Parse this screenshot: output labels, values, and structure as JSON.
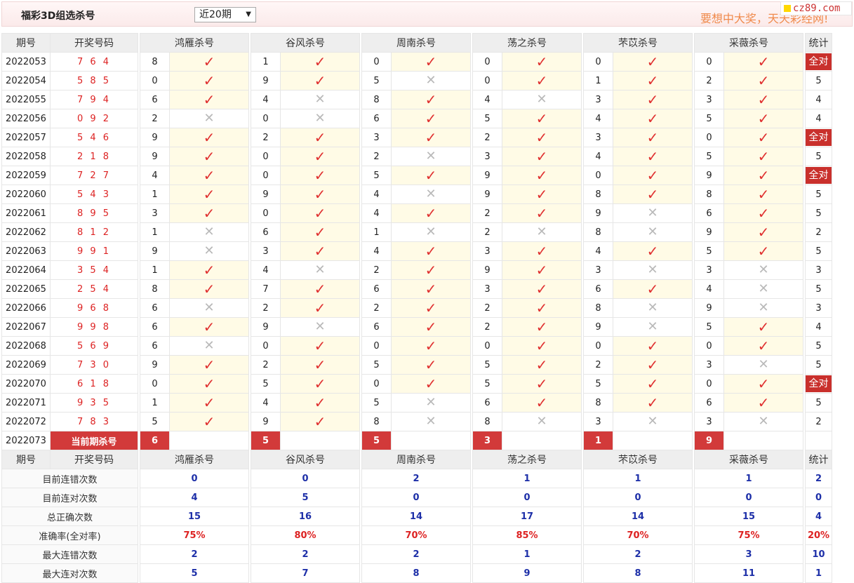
{
  "header": {
    "title": "福彩3D组选杀号",
    "select_value": "近20期",
    "select_arrow": "▼",
    "slogan": "要想中大奖，天天彩经网!",
    "logo": "cz89.com"
  },
  "columns": {
    "period": "期号",
    "draw": "开奖号码",
    "experts": [
      "鸿雁杀号",
      "谷风杀号",
      "周南杀号",
      "荡之杀号",
      "芣苡杀号",
      "采薇杀号"
    ],
    "stat": "统计"
  },
  "marks": {
    "ok": "✓",
    "no": "✕"
  },
  "rows": [
    {
      "period": "2022053",
      "draw": "7 6 4",
      "kills": [
        [
          8,
          1
        ],
        [
          1,
          1
        ],
        [
          0,
          1
        ],
        [
          0,
          1
        ],
        [
          0,
          1
        ],
        [
          0,
          1
        ]
      ],
      "stat": "全对"
    },
    {
      "period": "2022054",
      "draw": "5 8 5",
      "kills": [
        [
          0,
          1
        ],
        [
          9,
          1
        ],
        [
          5,
          0
        ],
        [
          0,
          1
        ],
        [
          1,
          1
        ],
        [
          2,
          1
        ]
      ],
      "stat": "5"
    },
    {
      "period": "2022055",
      "draw": "7 9 4",
      "kills": [
        [
          6,
          1
        ],
        [
          4,
          0
        ],
        [
          8,
          1
        ],
        [
          4,
          0
        ],
        [
          3,
          1
        ],
        [
          3,
          1
        ]
      ],
      "stat": "4"
    },
    {
      "period": "2022056",
      "draw": "0 9 2",
      "kills": [
        [
          2,
          0
        ],
        [
          0,
          0
        ],
        [
          6,
          1
        ],
        [
          5,
          1
        ],
        [
          4,
          1
        ],
        [
          5,
          1
        ]
      ],
      "stat": "4"
    },
    {
      "period": "2022057",
      "draw": "5 4 6",
      "kills": [
        [
          9,
          1
        ],
        [
          2,
          1
        ],
        [
          3,
          1
        ],
        [
          2,
          1
        ],
        [
          3,
          1
        ],
        [
          0,
          1
        ]
      ],
      "stat": "全对"
    },
    {
      "period": "2022058",
      "draw": "2 1 8",
      "kills": [
        [
          9,
          1
        ],
        [
          0,
          1
        ],
        [
          2,
          0
        ],
        [
          3,
          1
        ],
        [
          4,
          1
        ],
        [
          5,
          1
        ]
      ],
      "stat": "5"
    },
    {
      "period": "2022059",
      "draw": "7 2 7",
      "kills": [
        [
          4,
          1
        ],
        [
          0,
          1
        ],
        [
          5,
          1
        ],
        [
          9,
          1
        ],
        [
          0,
          1
        ],
        [
          9,
          1
        ]
      ],
      "stat": "全对"
    },
    {
      "period": "2022060",
      "draw": "5 4 3",
      "kills": [
        [
          1,
          1
        ],
        [
          9,
          1
        ],
        [
          4,
          0
        ],
        [
          9,
          1
        ],
        [
          8,
          1
        ],
        [
          8,
          1
        ]
      ],
      "stat": "5"
    },
    {
      "period": "2022061",
      "draw": "8 9 5",
      "kills": [
        [
          3,
          1
        ],
        [
          0,
          1
        ],
        [
          4,
          1
        ],
        [
          2,
          1
        ],
        [
          9,
          0
        ],
        [
          6,
          1
        ]
      ],
      "stat": "5"
    },
    {
      "period": "2022062",
      "draw": "8 1 2",
      "kills": [
        [
          1,
          0
        ],
        [
          6,
          1
        ],
        [
          1,
          0
        ],
        [
          2,
          0
        ],
        [
          8,
          0
        ],
        [
          9,
          1
        ]
      ],
      "stat": "2"
    },
    {
      "period": "2022063",
      "draw": "9 9 1",
      "kills": [
        [
          9,
          0
        ],
        [
          3,
          1
        ],
        [
          4,
          1
        ],
        [
          3,
          1
        ],
        [
          4,
          1
        ],
        [
          5,
          1
        ]
      ],
      "stat": "5"
    },
    {
      "period": "2022064",
      "draw": "3 5 4",
      "kills": [
        [
          1,
          1
        ],
        [
          4,
          0
        ],
        [
          2,
          1
        ],
        [
          9,
          1
        ],
        [
          3,
          0
        ],
        [
          3,
          0
        ]
      ],
      "stat": "3"
    },
    {
      "period": "2022065",
      "draw": "2 5 4",
      "kills": [
        [
          8,
          1
        ],
        [
          7,
          1
        ],
        [
          6,
          1
        ],
        [
          3,
          1
        ],
        [
          6,
          1
        ],
        [
          4,
          0
        ]
      ],
      "stat": "5"
    },
    {
      "period": "2022066",
      "draw": "9 6 8",
      "kills": [
        [
          6,
          0
        ],
        [
          2,
          1
        ],
        [
          2,
          1
        ],
        [
          2,
          1
        ],
        [
          8,
          0
        ],
        [
          9,
          0
        ]
      ],
      "stat": "3"
    },
    {
      "period": "2022067",
      "draw": "9 9 8",
      "kills": [
        [
          6,
          1
        ],
        [
          9,
          0
        ],
        [
          6,
          1
        ],
        [
          2,
          1
        ],
        [
          9,
          0
        ],
        [
          5,
          1
        ]
      ],
      "stat": "4"
    },
    {
      "period": "2022068",
      "draw": "5 6 9",
      "kills": [
        [
          6,
          0
        ],
        [
          0,
          1
        ],
        [
          0,
          1
        ],
        [
          0,
          1
        ],
        [
          0,
          1
        ],
        [
          0,
          1
        ]
      ],
      "stat": "5"
    },
    {
      "period": "2022069",
      "draw": "7 3 0",
      "kills": [
        [
          9,
          1
        ],
        [
          2,
          1
        ],
        [
          5,
          1
        ],
        [
          5,
          1
        ],
        [
          2,
          1
        ],
        [
          3,
          0
        ]
      ],
      "stat": "5"
    },
    {
      "period": "2022070",
      "draw": "6 1 8",
      "kills": [
        [
          0,
          1
        ],
        [
          5,
          1
        ],
        [
          0,
          1
        ],
        [
          5,
          1
        ],
        [
          5,
          1
        ],
        [
          0,
          1
        ]
      ],
      "stat": "全对"
    },
    {
      "period": "2022071",
      "draw": "9 3 5",
      "kills": [
        [
          1,
          1
        ],
        [
          4,
          1
        ],
        [
          5,
          0
        ],
        [
          6,
          1
        ],
        [
          8,
          1
        ],
        [
          6,
          1
        ]
      ],
      "stat": "5"
    },
    {
      "period": "2022072",
      "draw": "7 8 3",
      "kills": [
        [
          5,
          1
        ],
        [
          9,
          1
        ],
        [
          8,
          0
        ],
        [
          8,
          0
        ],
        [
          3,
          0
        ],
        [
          3,
          0
        ]
      ],
      "stat": "2"
    }
  ],
  "current": {
    "period": "2022073",
    "label": "当前期杀号",
    "kills": [
      "6",
      "5",
      "5",
      "3",
      "1",
      "9"
    ]
  },
  "summary": [
    {
      "label": "目前连错次数",
      "values": [
        "0",
        "0",
        "2",
        "1",
        "1",
        "1"
      ],
      "stat": "2",
      "rate": false
    },
    {
      "label": "目前连对次数",
      "values": [
        "4",
        "5",
        "0",
        "0",
        "0",
        "0"
      ],
      "stat": "0",
      "rate": false
    },
    {
      "label": "总正确次数",
      "values": [
        "15",
        "16",
        "14",
        "17",
        "14",
        "15"
      ],
      "stat": "4",
      "rate": false
    },
    {
      "label": "准确率(全对率)",
      "values": [
        "75%",
        "80%",
        "70%",
        "85%",
        "70%",
        "75%"
      ],
      "stat": "20%",
      "rate": true
    },
    {
      "label": "最大连错次数",
      "values": [
        "2",
        "2",
        "2",
        "1",
        "2",
        "3"
      ],
      "stat": "10",
      "rate": false
    },
    {
      "label": "最大连对次数",
      "values": [
        "5",
        "7",
        "8",
        "9",
        "8",
        "11"
      ],
      "stat": "1",
      "rate": false
    }
  ]
}
